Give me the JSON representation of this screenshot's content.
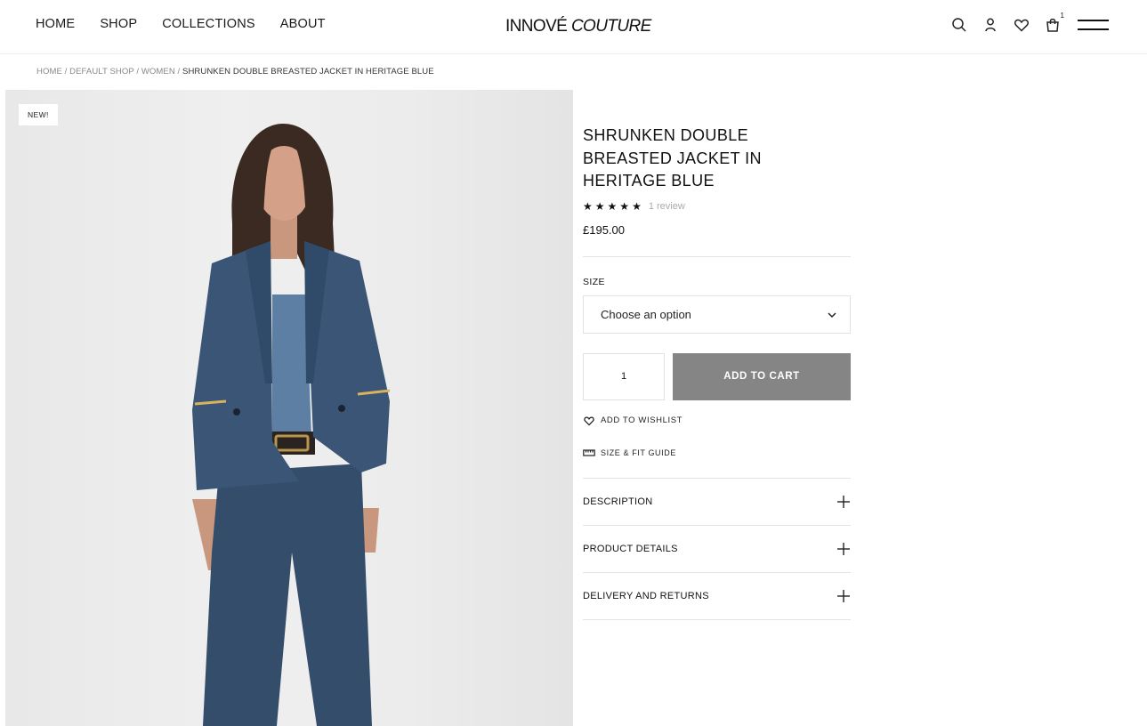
{
  "header": {
    "nav": [
      "HOME",
      "SHOP",
      "COLLECTIONS",
      "ABOUT"
    ],
    "logo_part1": "INNOVÉ",
    "logo_part2": "COUTURE",
    "cart_count": "1",
    "icons": [
      "search-icon",
      "account-icon",
      "heart-icon",
      "bag-icon",
      "menu-icon"
    ]
  },
  "breadcrumb": {
    "items": [
      "HOME",
      "DEFAULT SHOP",
      "WOMEN"
    ],
    "separator": " / ",
    "current": "SHRUNKEN DOUBLE BREASTED JACKET IN HERITAGE BLUE"
  },
  "product": {
    "badge": "NEW!",
    "title": "SHRUNKEN DOUBLE BREASTED JACKET IN HERITAGE BLUE",
    "rating": 5,
    "rating_max": 5,
    "review_text": "1 review",
    "price": "£195.00",
    "size_label": "SIZE",
    "size_placeholder": "Choose an option",
    "quantity": "1",
    "add_to_cart": "ADD TO CART",
    "wishlist": "ADD TO WISHLIST",
    "size_guide": "SIZE & FIT GUIDE",
    "accordions": [
      "DESCRIPTION",
      "PRODUCT DETAILS",
      "DELIVERY AND RETURNS"
    ]
  },
  "colors": {
    "jacket": "#3a5576",
    "button_bg": "#858585",
    "photo_bg": "#ececec"
  }
}
